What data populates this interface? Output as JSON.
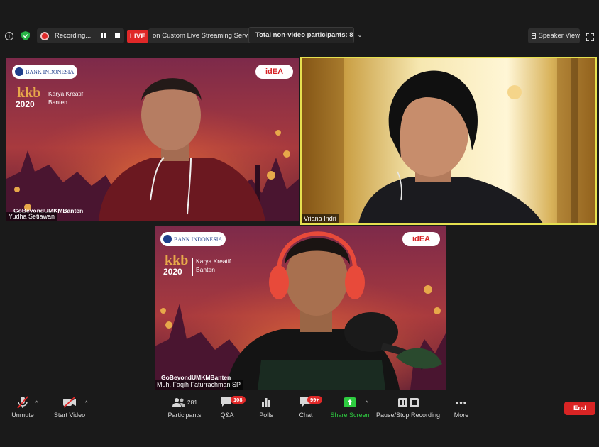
{
  "topbar": {
    "recording_label": "Recording...",
    "live_label": "LIVE",
    "streaming_label": "on Custom Live Streaming Service",
    "participants_label": "Total non-video participants: 8",
    "view_label": "Speaker View"
  },
  "tiles": {
    "t1": {
      "name": "Yudha Setiawan",
      "tag": "GoBeyondUMKMBanten",
      "logo_bank": "BANK INDONESIA",
      "logo_idea": "idEA",
      "kkb_top": "kkb",
      "kkb_year": "2020",
      "kkb_sub1": "Karya Kreatif",
      "kkb_sub2": "Banten"
    },
    "t2": {
      "name": "Vriana Indri"
    },
    "t3": {
      "name": "Muh. Faqih Faturrachman SP",
      "tag": "GoBeyondUMKMBanten",
      "logo_bank": "BANK INDONESIA",
      "logo_idea": "idEA",
      "kkb_top": "kkb",
      "kkb_year": "2020",
      "kkb_sub1": "Karya Kreatif",
      "kkb_sub2": "Banten"
    }
  },
  "toolbar": {
    "unmute": "Unmute",
    "start_video": "Start Video",
    "participants": "Participants",
    "participants_count": "281",
    "qa": "Q&A",
    "qa_badge": "108",
    "polls": "Polls",
    "chat": "Chat",
    "chat_badge": "99+",
    "share_screen": "Share Screen",
    "pause_recording": "Pause/Stop Recording",
    "more": "More",
    "end": "End"
  },
  "colors": {
    "live_red": "#e02828",
    "share_green": "#2ecc40",
    "active_speaker_border": "#e5e04f",
    "end_red": "#d92424"
  }
}
